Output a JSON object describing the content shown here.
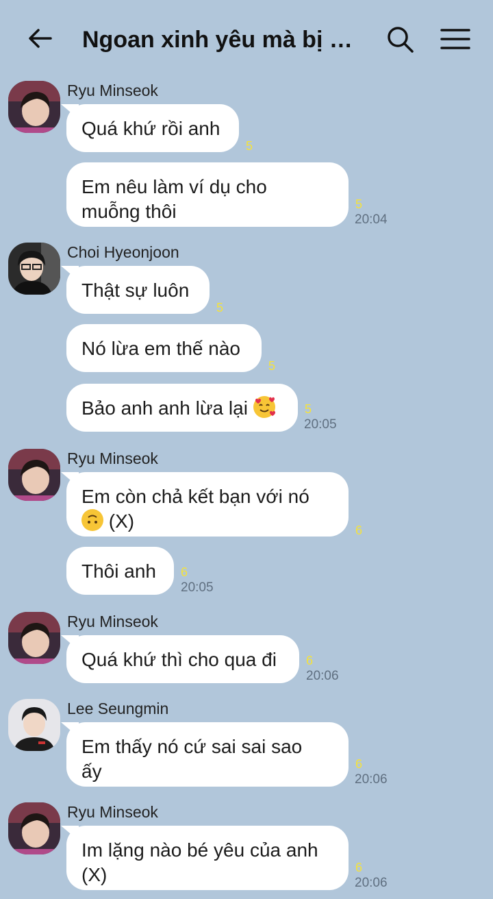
{
  "header": {
    "title": "Ngoan xinh yêu mà bị t..."
  },
  "messages": {
    "m1": {
      "sender": "Ryu Minseok",
      "text": "Quá khứ rồi anh",
      "unread": "5"
    },
    "m2": {
      "line1": "Em nêu làm ví dụ cho",
      "line2": "muỗng thôi",
      "unread": "5",
      "time": "20:04"
    },
    "m3": {
      "sender": "Choi Hyeonjoon",
      "text": "Thật sự luôn",
      "unread": "5"
    },
    "m4": {
      "text": "Nó lừa em thế nào",
      "unread": "5"
    },
    "m5": {
      "text": "Bảo anh anh lừa lại",
      "unread": "5",
      "time": "20:05"
    },
    "m6": {
      "sender": "Ryu Minseok",
      "line1": "Em còn chả kết bạn với nó",
      "line2": "(X)",
      "unread": "6"
    },
    "m7": {
      "text": "Thôi anh",
      "unread": "6",
      "time": "20:05"
    },
    "m8": {
      "sender": "Ryu Minseok",
      "text": "Quá khứ thì cho qua đi",
      "unread": "6",
      "time": "20:06"
    },
    "m9": {
      "sender": "Lee Seungmin",
      "line1": "Em thấy nó cứ sai sai sao",
      "line2": "ấy",
      "unread": "6",
      "time": "20:06"
    },
    "m10": {
      "sender": "Ryu Minseok",
      "line1": "Im lặng nào bé yêu của anh",
      "line2": "(X)",
      "unread": "6",
      "time": "20:06"
    }
  },
  "icons": {
    "back": "arrow-left-icon",
    "search": "search-icon",
    "menu": "hamburger-menu-icon",
    "emoji_smiling_hearts": "smiling-face-with-hearts-emoji",
    "emoji_upside_down": "upside-down-face-emoji"
  },
  "colors": {
    "background": "#b1c6da",
    "bubble": "#ffffff",
    "unread": "#f5e23b",
    "time": "#5f6f80"
  }
}
